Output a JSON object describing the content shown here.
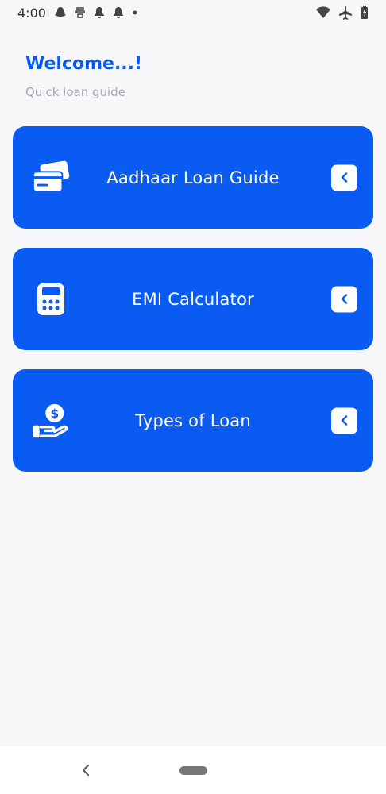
{
  "status_bar": {
    "time": "4:00",
    "left_icons": [
      "snapchat-icon",
      "cast-icon",
      "notification-icon",
      "notification-icon",
      "dot-icon"
    ],
    "right_icons": [
      "wifi-icon",
      "airplane-icon",
      "battery-icon"
    ]
  },
  "header": {
    "title": "Welcome...!",
    "subtitle": "Quick loan guide"
  },
  "cards": [
    {
      "label": "Aadhaar Loan Guide",
      "icon": "credit-cards-icon"
    },
    {
      "label": "EMI Calculator",
      "icon": "calculator-icon"
    },
    {
      "label": "Types of Loan",
      "icon": "money-hand-icon"
    }
  ],
  "colors": {
    "accent": "#0A5BF2",
    "background": "#F7F7FA",
    "subtitle": "#A9A9AE",
    "card_text": "#FFFFFF"
  },
  "nav_bar": {
    "icons": [
      "back-icon",
      "home-pill-icon"
    ]
  }
}
